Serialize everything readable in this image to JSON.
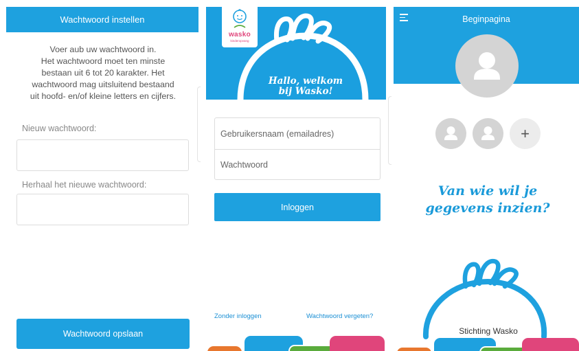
{
  "set_password": {
    "header_title": "Wachtwoord instellen",
    "instructions": [
      "Voer aub uw wachtwoord in.",
      "Het wachtwoord moet ten minste",
      "bestaan uit 6 tot 20 karakter. Het",
      "wachtwoord mag uitsluitend bestaand",
      "uit hoofd- en/of kleine letters en cijfers."
    ],
    "new_password_label": "Nieuw wachtwoord:",
    "repeat_password_label": "Herhaal het nieuwe wachtwoord:",
    "save_button": "Wachtwoord opslaan"
  },
  "login": {
    "logo_text": "wasko",
    "logo_subtext": "kinderopvang",
    "greeting_line1": "Hallo, welkom",
    "greeting_line2": "bij Wasko!",
    "username_placeholder": "Gebruikersnaam (emailadres)",
    "password_placeholder": "Wachtwoord",
    "login_button": "Inloggen",
    "without_login_link": "Zonder inloggen",
    "forgot_password_link": "Wachtwoord vergeten?"
  },
  "home": {
    "header_title": "Beginpagina",
    "add_profile_symbol": "+",
    "question_line1": "Van wie wil je",
    "question_line2": "gegevens inzien?",
    "organization": "Stichting Wasko"
  },
  "colors": {
    "brand_blue": "#1ea1df",
    "brand_pink": "#e0457b",
    "brand_green": "#5aab3c",
    "brand_orange": "#e8772e"
  }
}
